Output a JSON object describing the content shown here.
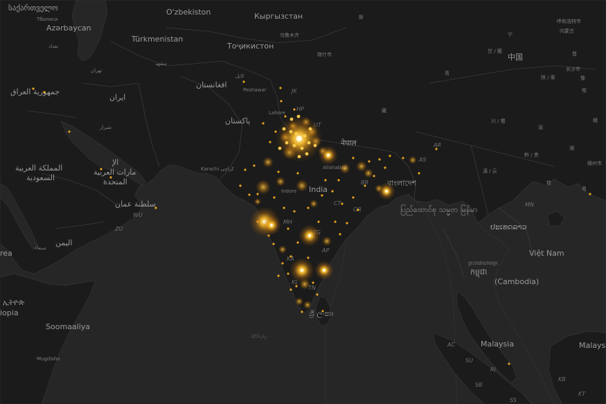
{
  "map": {
    "style": "dark",
    "colors": {
      "sea": "#262626",
      "land": "#1a1a1a",
      "border": "#3a3a3a",
      "hotspot": "#ffb020"
    },
    "country_labels": [
      {
        "id": "georgia",
        "text": "საქართველო"
      },
      {
        "id": "uzbekistan",
        "text": "O'zbekiston"
      },
      {
        "id": "kyrgyzstan",
        "text": "Кыргызстан"
      },
      {
        "id": "xinjiang",
        "text": "新"
      },
      {
        "id": "azerbaijan",
        "text": "Azərbaycan"
      },
      {
        "id": "turkmenistan",
        "text": "Türkmenistan"
      },
      {
        "id": "tajikistan",
        "text": "Тоҷикистон"
      },
      {
        "id": "afghanistan",
        "text": "افغانستان"
      },
      {
        "id": "iraq",
        "text": "جمهورية العراق"
      },
      {
        "id": "iran",
        "text": "ایران"
      },
      {
        "id": "pakistan",
        "text": "پاکستان"
      },
      {
        "id": "nepal",
        "text": "नेपाल"
      },
      {
        "id": "saudi1",
        "text": "المملكة العربية"
      },
      {
        "id": "saudi2",
        "text": "السعودية"
      },
      {
        "id": "uae1",
        "text": "الإ"
      },
      {
        "id": "uae2",
        "text": "مارات العربية"
      },
      {
        "id": "uae3",
        "text": "المتحدة"
      },
      {
        "id": "oman",
        "text": "سلطنة عمان"
      },
      {
        "id": "india",
        "text": "India"
      },
      {
        "id": "bangladesh",
        "text": "বাংলাদেশ"
      },
      {
        "id": "myanmar",
        "text": "ပြည်ထောင်စု သမ္မတ မြန်မာ"
      },
      {
        "id": "laos",
        "text": "ປະເທດລາວ"
      },
      {
        "id": "vietnam",
        "text": "Việt Nam"
      },
      {
        "id": "yemen",
        "text": "اليمن"
      },
      {
        "id": "eritrea",
        "text": "rea"
      },
      {
        "id": "ethiopia1",
        "text": "ኢትዮጵ"
      },
      {
        "id": "ethiopia2",
        "text": "iopia"
      },
      {
        "id": "somalia",
        "text": "Soomaaliya"
      },
      {
        "id": "srilanka",
        "text": "ශ්‍රී ලංකා"
      },
      {
        "id": "cambodia1",
        "text": "ព្រះរាជាណាចក្រ"
      },
      {
        "id": "cambodia2",
        "text": "កម្ពុជា"
      },
      {
        "id": "cambodia3",
        "text": "(Cambodia)"
      },
      {
        "id": "malaysia1",
        "text": "Malaysia"
      },
      {
        "id": "malaysia2",
        "text": "Malays"
      },
      {
        "id": "china",
        "text": "中国"
      },
      {
        "id": "gansu",
        "text": "甘 / 隴"
      },
      {
        "id": "qinghai",
        "text": "青"
      },
      {
        "id": "tibet",
        "text": "藏"
      },
      {
        "id": "sichuan",
        "text": "川 / 蜀"
      },
      {
        "id": "guizhou",
        "text": "黔 / 贵"
      },
      {
        "id": "yunnan",
        "text": "滇 / 云"
      },
      {
        "id": "guangxi",
        "text": "桂"
      },
      {
        "id": "shaanxi",
        "text": "陕 / 秦"
      },
      {
        "id": "ningxia",
        "text": "宁"
      },
      {
        "id": "neimenggu",
        "text": "内蒙古"
      },
      {
        "id": "shanxi",
        "text": "晋"
      },
      {
        "id": "henan",
        "text": "豫"
      },
      {
        "id": "hubei",
        "text": "鄂"
      },
      {
        "id": "hunan",
        "text": "湘"
      },
      {
        "id": "chongqing",
        "text": "渝"
      },
      {
        "id": "guangdong",
        "text": "粤"
      },
      {
        "id": "jiangxi",
        "text": "赣"
      }
    ],
    "city_labels": [
      {
        "id": "tbilisi",
        "text": "Тбилиси"
      },
      {
        "id": "karachi",
        "text": "Karachi کراچی"
      },
      {
        "id": "peshawar",
        "text": "Peshawar"
      },
      {
        "id": "lahore",
        "text": "Lahore"
      },
      {
        "id": "allahabad",
        "text": "Allahabad"
      },
      {
        "id": "indore",
        "text": "Indore"
      },
      {
        "id": "tehran",
        "text": "تهران"
      },
      {
        "id": "mashhad",
        "text": "مشهد"
      },
      {
        "id": "shiraz",
        "text": "شیراز"
      },
      {
        "id": "sanaa",
        "text": "صنعاء"
      },
      {
        "id": "mogadishu",
        "text": "Mugdisho"
      },
      {
        "id": "hohhot",
        "text": "呼和浩特市"
      },
      {
        "id": "changsha",
        "text": "长沙市"
      },
      {
        "id": "ganzhou",
        "text": "赣州市"
      },
      {
        "id": "urumqi",
        "text": "乌鲁木齐"
      },
      {
        "id": "kashgar",
        "text": "喀什市"
      },
      {
        "id": "baghdad",
        "text": "بغداد"
      },
      {
        "id": "kabul",
        "text": "كابل"
      }
    ],
    "region_codes": [
      {
        "id": "jk",
        "text": "JK"
      },
      {
        "id": "hp",
        "text": "HP"
      },
      {
        "id": "ut",
        "text": "UT"
      },
      {
        "id": "ar",
        "text": "AR"
      },
      {
        "id": "as",
        "text": "AS"
      },
      {
        "id": "br",
        "text": "BR"
      },
      {
        "id": "or",
        "text": "OR"
      },
      {
        "id": "ct",
        "text": "CT"
      },
      {
        "id": "mh",
        "text": "MH"
      },
      {
        "id": "tg",
        "text": "TG"
      },
      {
        "id": "ap",
        "text": "AP"
      },
      {
        "id": "ka",
        "text": "KA"
      },
      {
        "id": "tn",
        "text": "TN"
      },
      {
        "id": "kl",
        "text": "KL"
      },
      {
        "id": "mn",
        "text": "MN"
      },
      {
        "id": "wu",
        "text": "WU"
      },
      {
        "id": "zu",
        "text": "ZU"
      },
      {
        "id": "ac",
        "text": "AC"
      },
      {
        "id": "su",
        "text": "SU"
      },
      {
        "id": "ri",
        "text": "RI"
      },
      {
        "id": "sb",
        "text": "SB"
      },
      {
        "id": "ss",
        "text": "SS"
      },
      {
        "id": "kb",
        "text": "KB"
      },
      {
        "id": "kt",
        "text": "KT"
      }
    ],
    "water_labels": [
      {
        "id": "maldives",
        "text": "ދިވެހިރާއްޖޭގެ"
      }
    ],
    "hotspot_levels": {
      "delhi": 1.0,
      "mumbai": 0.85,
      "bangalore": 0.8,
      "chennai": 0.7,
      "hyderabad": 0.7,
      "kolkata": 0.65,
      "lucknow": 0.6
    }
  }
}
